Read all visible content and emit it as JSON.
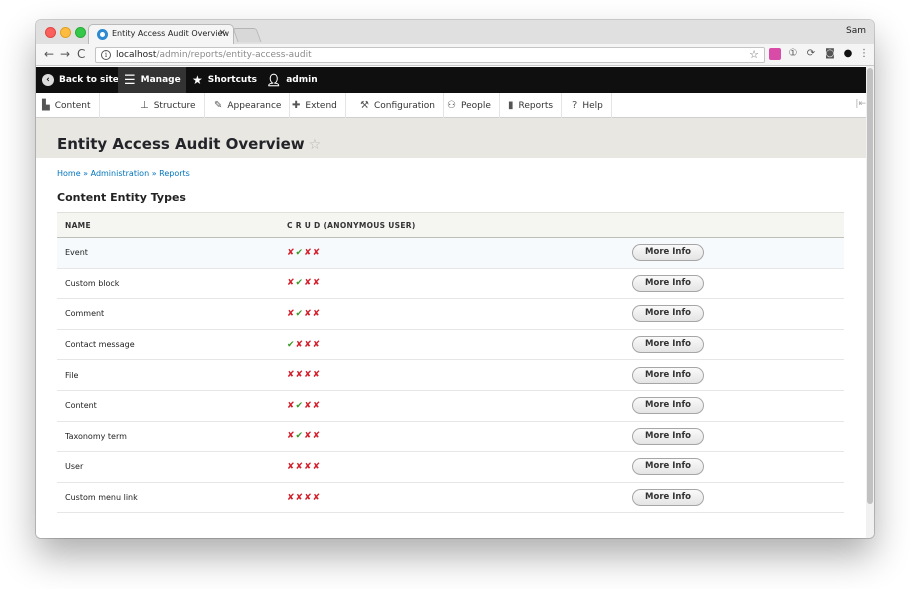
{
  "browser": {
    "tab_title": "Entity Access Audit Overview",
    "tab_close": "×",
    "profile": "Sam",
    "url_host": "localhost",
    "url_path": "/admin/reports/entity-access-audit"
  },
  "drupal_toolbar": {
    "back": "Back to site",
    "manage": "Manage",
    "shortcuts": "Shortcuts",
    "user": "admin"
  },
  "admin_menu": [
    "Content",
    "Structure",
    "Appearance",
    "Extend",
    "Configuration",
    "People",
    "Reports",
    "Help"
  ],
  "page": {
    "title": "Entity Access Audit Overview",
    "breadcrumb": "Home » Administration » Reports",
    "section_title": "Content Entity Types"
  },
  "table": {
    "headers": {
      "name": "NAME",
      "crud": "C R U D (ANONYMOUS USER)"
    },
    "button_label": "More Info",
    "rows": [
      {
        "name": "Event",
        "crud": [
          false,
          true,
          false,
          false
        ]
      },
      {
        "name": "Custom block",
        "crud": [
          false,
          true,
          false,
          false
        ]
      },
      {
        "name": "Comment",
        "crud": [
          false,
          true,
          false,
          false
        ]
      },
      {
        "name": "Contact message",
        "crud": [
          true,
          false,
          false,
          false
        ]
      },
      {
        "name": "File",
        "crud": [
          false,
          false,
          false,
          false
        ]
      },
      {
        "name": "Content",
        "crud": [
          false,
          true,
          false,
          false
        ]
      },
      {
        "name": "Taxonomy term",
        "crud": [
          false,
          true,
          false,
          false
        ]
      },
      {
        "name": "User",
        "crud": [
          false,
          false,
          false,
          false
        ]
      },
      {
        "name": "Custom menu link",
        "crud": [
          false,
          false,
          false,
          false
        ]
      }
    ]
  },
  "colors": {
    "allowed": "#3a9a28",
    "denied": "#d21f2b",
    "link": "#0074bd"
  }
}
